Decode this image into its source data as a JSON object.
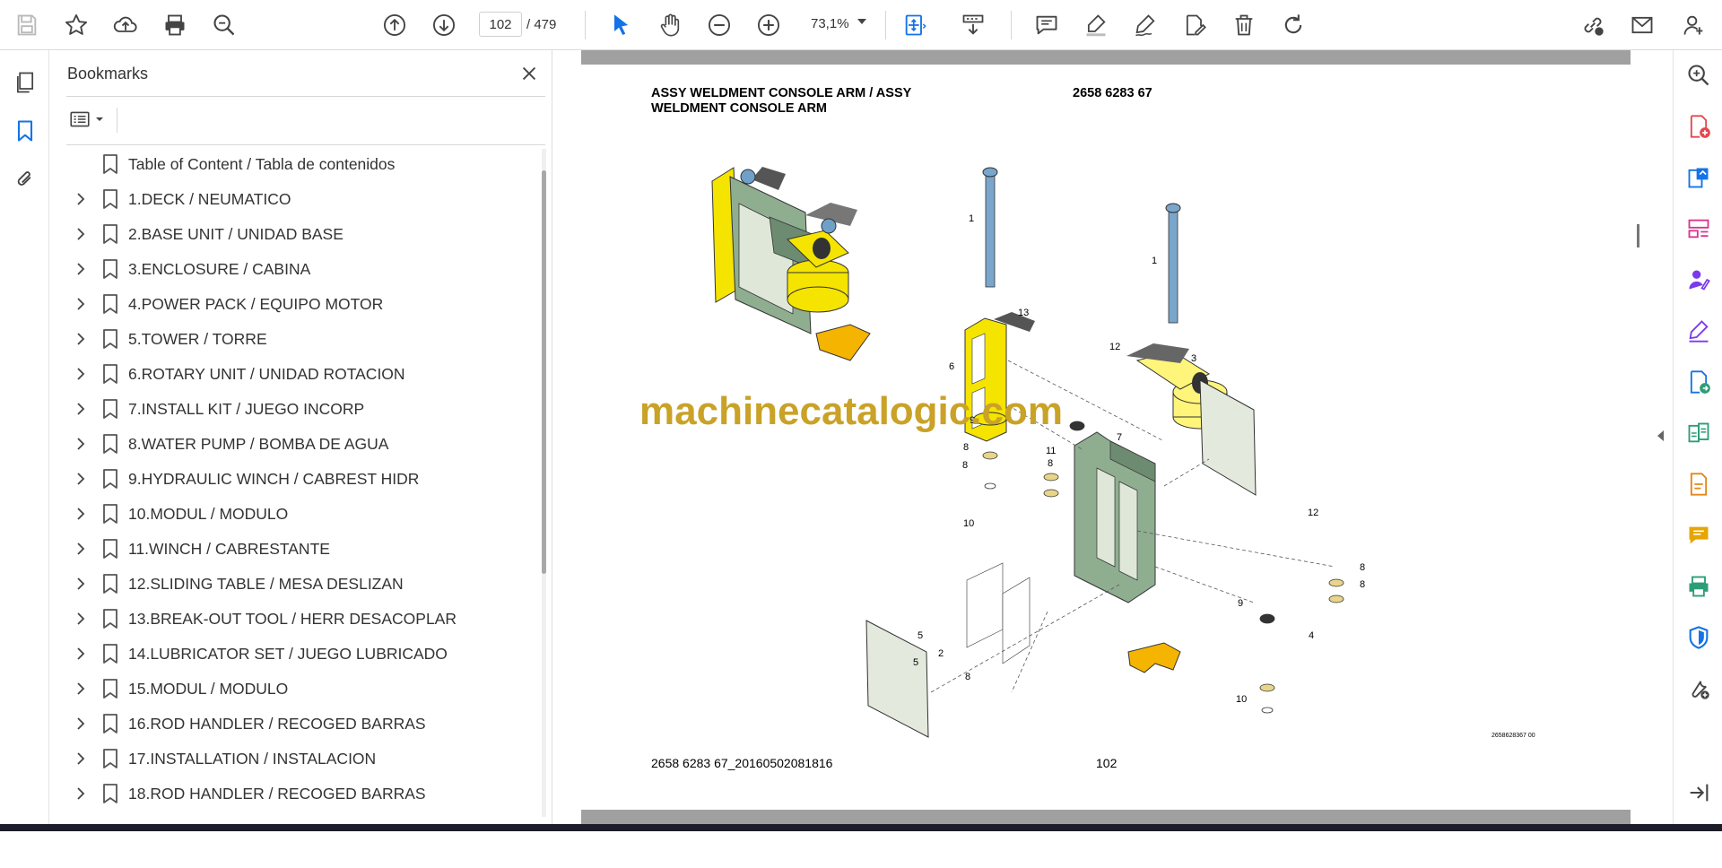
{
  "toolbar": {
    "current_page": "102",
    "total_pages": "/ 479",
    "zoom": "73,1%",
    "icons": [
      "save-icon",
      "star-icon",
      "upload-icon",
      "print-icon",
      "find-icon",
      "page-up-icon",
      "page-down-icon",
      "select-arrow-icon",
      "hand-icon",
      "zoom-out-icon",
      "zoom-in-icon",
      "fit-page-icon",
      "scroll-mode-icon",
      "comment-icon",
      "highlight-icon",
      "draw-icon",
      "edit-icon",
      "delete-icon",
      "rotate-icon",
      "share-link-icon",
      "mail-icon",
      "account-icon"
    ]
  },
  "bookmarks": {
    "title": "Bookmarks",
    "items": [
      {
        "label": "Table of Content / Tabla de contenidos",
        "expandable": false
      },
      {
        "label": "1.DECK / NEUMATICO",
        "expandable": true
      },
      {
        "label": "2.BASE UNIT / UNIDAD BASE",
        "expandable": true
      },
      {
        "label": "3.ENCLOSURE / CABINA",
        "expandable": true
      },
      {
        "label": "4.POWER PACK / EQUIPO MOTOR",
        "expandable": true
      },
      {
        "label": "5.TOWER / TORRE",
        "expandable": true
      },
      {
        "label": "6.ROTARY UNIT / UNIDAD ROTACION",
        "expandable": true
      },
      {
        "label": "7.INSTALL KIT / JUEGO INCORP",
        "expandable": true
      },
      {
        "label": "8.WATER PUMP / BOMBA DE AGUA",
        "expandable": true
      },
      {
        "label": "9.HYDRAULIC WINCH / CABREST HIDR",
        "expandable": true
      },
      {
        "label": "10.MODUL / MODULO",
        "expandable": true
      },
      {
        "label": "11.WINCH / CABRESTANTE",
        "expandable": true
      },
      {
        "label": "12.SLIDING TABLE / MESA DESLIZAN",
        "expandable": true
      },
      {
        "label": "13.BREAK-OUT TOOL / HERR DESACOPLAR",
        "expandable": true
      },
      {
        "label": "14.LUBRICATOR SET / JUEGO LUBRICADO",
        "expandable": true
      },
      {
        "label": "15.MODUL / MODULO",
        "expandable": true
      },
      {
        "label": "16.ROD HANDLER / RECOGED BARRAS",
        "expandable": true
      },
      {
        "label": "17.INSTALLATION / INSTALACION",
        "expandable": true
      },
      {
        "label": "18.ROD HANDLER / RECOGED BARRAS",
        "expandable": true
      }
    ]
  },
  "document": {
    "title": "ASSY WELDMENT CONSOLE ARM / ASSY WELDMENT CONSOLE ARM",
    "part_number": "2658 6283 67",
    "footer_id": "2658 6283 67_20160502081816",
    "page_number": "102",
    "drawing_ref": "2658628367 00",
    "watermark": "machinecatalogic.com",
    "callouts": [
      "1",
      "1",
      "13",
      "6",
      "12",
      "3",
      "9",
      "7",
      "11",
      "8",
      "8",
      "8",
      "10",
      "5",
      "12",
      "8",
      "8",
      "9",
      "4",
      "2",
      "5",
      "8",
      "10"
    ]
  },
  "colors": {
    "accent_blue": "#1473e6",
    "tool_red": "#e34850",
    "tool_pink": "#d83790",
    "tool_purple": "#7c3aed",
    "tool_green": "#2d9d78",
    "tool_orange": "#e68619",
    "tool_yellow": "#e6a500",
    "watermark_gold": "#c9a227"
  }
}
